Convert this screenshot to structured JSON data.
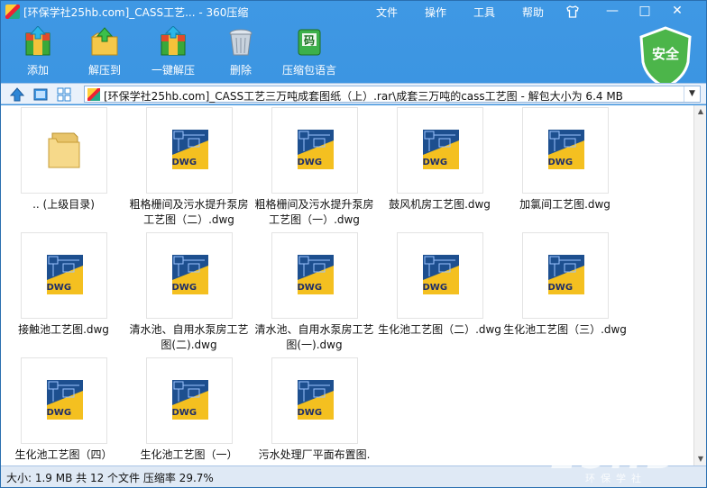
{
  "title": "[环保学社25hb.com]_CASS工艺... - 360压缩",
  "menu": [
    "文件",
    "操作",
    "工具",
    "帮助"
  ],
  "toolbar": [
    {
      "label": "添加",
      "icon": "add-archive-icon"
    },
    {
      "label": "解压到",
      "icon": "extract-to-icon"
    },
    {
      "label": "一键解压",
      "icon": "one-click-extract-icon"
    },
    {
      "label": "删除",
      "icon": "delete-trash-icon"
    },
    {
      "label": "压缩包语言",
      "icon": "archive-language-icon"
    }
  ],
  "security_badge": "安全",
  "code_badge": "码",
  "address": "[环保学社25hb.com]_CASS工艺三万吨成套图纸（上）.rar\\成套三万吨的cass工艺图 - 解包大小为 6.4 MB",
  "thumb_badge": "DWG",
  "files": [
    {
      "name": ".. (上级目录)",
      "type": "folder"
    },
    {
      "name": "粗格栅间及污水提升泵房工艺图（二）.dwg",
      "type": "dwg"
    },
    {
      "name": "粗格栅间及污水提升泵房工艺图（一）.dwg",
      "type": "dwg"
    },
    {
      "name": "鼓风机房工艺图.dwg",
      "type": "dwg"
    },
    {
      "name": "加氯间工艺图.dwg",
      "type": "dwg"
    },
    {
      "name": "接触池工艺图.dwg",
      "type": "dwg"
    },
    {
      "name": "清水池、自用水泵房工艺图(二).dwg",
      "type": "dwg"
    },
    {
      "name": "清水池、自用水泵房工艺图(一).dwg",
      "type": "dwg"
    },
    {
      "name": "生化池工艺图（二）.dwg",
      "type": "dwg"
    },
    {
      "name": "生化池工艺图（三）.dwg",
      "type": "dwg"
    },
    {
      "name": "生化池工艺图（四）",
      "type": "dwg"
    },
    {
      "name": "生化池工艺图（一）",
      "type": "dwg"
    },
    {
      "name": "污水处理厂平面布置图.",
      "type": "dwg"
    }
  ],
  "status": "大小: 1.9 MB 共 12 个文件 压缩率 29.7%",
  "watermark": {
    "big": "25HB",
    "small": "环保学社"
  }
}
